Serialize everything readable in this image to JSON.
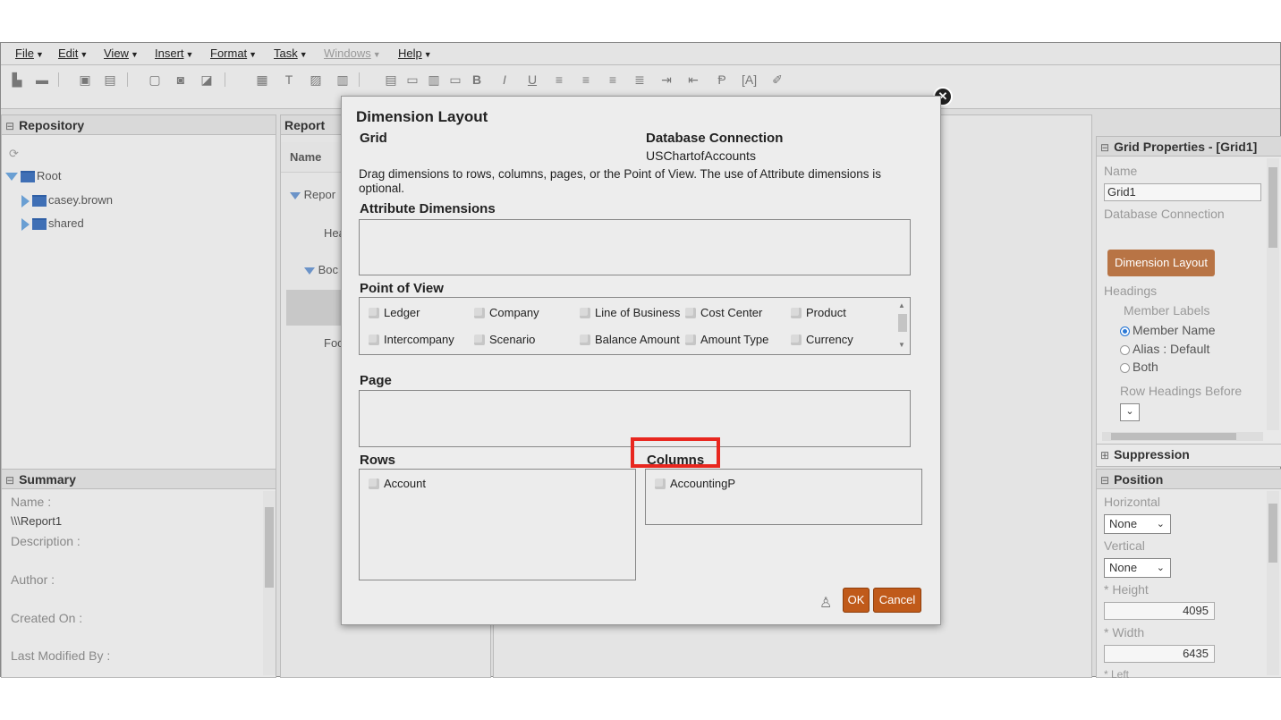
{
  "menu": [
    {
      "label": "File",
      "disabled": false
    },
    {
      "label": "Edit",
      "disabled": false
    },
    {
      "label": "View",
      "disabled": false
    },
    {
      "label": "Insert",
      "disabled": false
    },
    {
      "label": "Format",
      "disabled": false
    },
    {
      "label": "Task",
      "disabled": false
    },
    {
      "label": "Windows",
      "disabled": true
    },
    {
      "label": "Help",
      "disabled": false
    }
  ],
  "repository": {
    "title": "Repository",
    "items": [
      "Root",
      "casey.brown",
      "shared"
    ]
  },
  "report": {
    "title": "Report",
    "column_header": "Name",
    "rows": [
      "Repor",
      "Hea",
      "Boc",
      "Foo"
    ]
  },
  "summary": {
    "title": "Summary",
    "name_label": "Name :",
    "name_value": "\\\\\\Report1",
    "description_label": "Description :",
    "author_label": "Author :",
    "created_label": "Created On :",
    "modified_label": "Last Modified By :"
  },
  "grid_props": {
    "title": "Grid Properties - [Grid1]",
    "name_label": "Name",
    "name_value": "Grid1",
    "db_label": "Database Connection",
    "dimension_layout_button": "Dimension Layout",
    "headings_label": "Headings",
    "member_labels": "Member Labels",
    "options": [
      "Member Name",
      "Alias : Default",
      "Both"
    ],
    "selected_option": "Member Name",
    "row_headings_before": "Row Headings Before"
  },
  "suppression": {
    "title": "Suppression"
  },
  "position": {
    "title": "Position",
    "horizontal_label": "Horizontal",
    "horizontal_value": "None",
    "vertical_label": "Vertical",
    "vertical_value": "None",
    "height_label": "* Height",
    "height_value": "4095",
    "width_label": "* Width",
    "width_value": "6435",
    "left_label": "* Left"
  },
  "dialog": {
    "title": "Dimension Layout",
    "grid_label": "Grid",
    "db_conn_label": "Database Connection",
    "db_conn_value": "USChartofAccounts",
    "instructions": "Drag dimensions to rows, columns, pages, or the Point of View. The use of Attribute dimensions is optional.",
    "attribute_label": "Attribute Dimensions",
    "pov_label": "Point of View",
    "pov_items": [
      "Ledger",
      "Company",
      "Line of Business",
      "Cost Center",
      "Product",
      "Intercompany",
      "Scenario",
      "Balance Amount",
      "Amount Type",
      "Currency"
    ],
    "page_label": "Page",
    "rows_label": "Rows",
    "rows_items": [
      "Account"
    ],
    "columns_label": "Columns",
    "columns_items": [
      "AccountingP"
    ],
    "ok": "OK",
    "cancel": "Cancel",
    "highlight_color": "#e8271f",
    "accent_color": "#c05a1a"
  }
}
